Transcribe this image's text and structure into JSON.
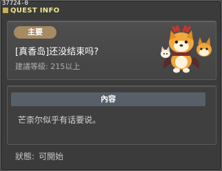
{
  "window": {
    "id_label": "37724-0",
    "title": "QUEST INFO"
  },
  "quest": {
    "category_badge": "主要",
    "name": "[真香岛]还没结束吗?",
    "level_requirement": "建議等級: 215以上"
  },
  "npc": {
    "icon": "dog-npc-portrait"
  },
  "content": {
    "header": "內容",
    "text": "芒柰尔似乎有话要说。"
  },
  "status": {
    "label": "狀態:",
    "value": "可開始"
  }
}
